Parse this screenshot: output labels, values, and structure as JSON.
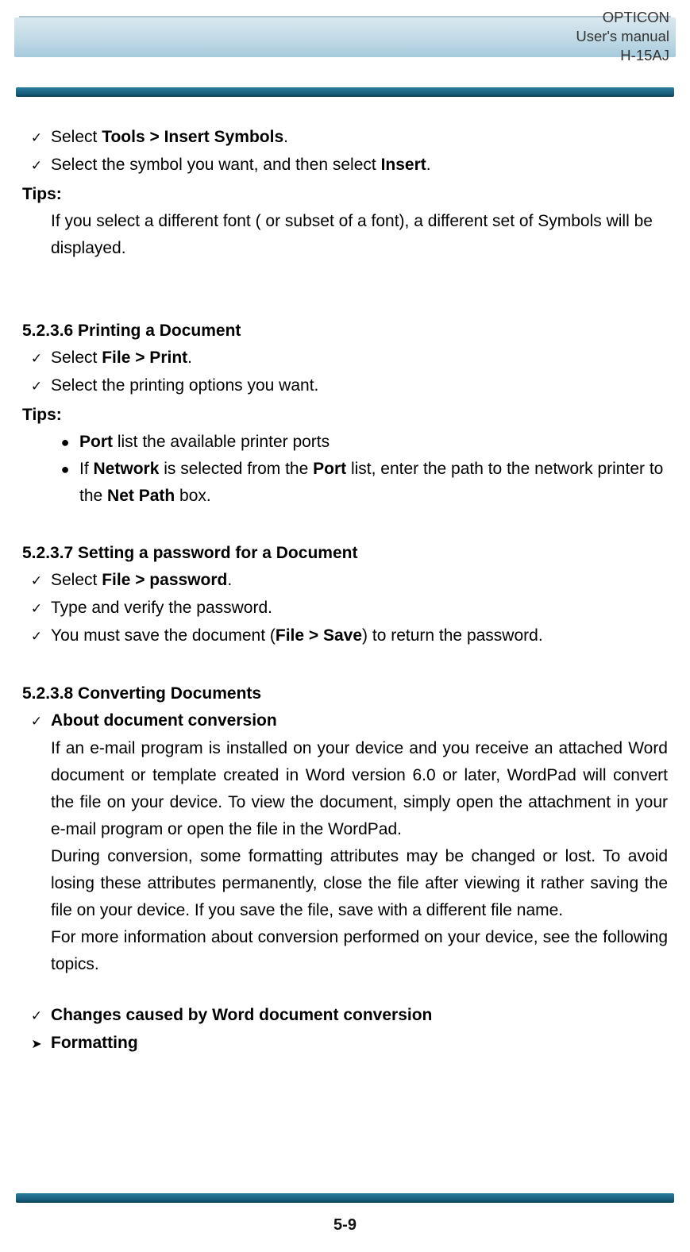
{
  "header": {
    "brand": "OPTICON",
    "doc": "User's manual",
    "model": "H-15AJ"
  },
  "page_number": "5-9",
  "content": {
    "insert_symbols": {
      "step1": {
        "pre": "Select ",
        "bold": "Tools > Insert Symbols",
        "post": "."
      },
      "step2": {
        "pre": "Select the symbol you want, and then select ",
        "bold": "Insert",
        "post": "."
      },
      "tips_label": "Tips:",
      "tip_text": "If you select a different font ( or subset of a font), a different set of Symbols will be displayed."
    },
    "printing": {
      "heading": "5.2.3.6 Printing a Document",
      "step1": {
        "pre": "Select ",
        "bold": "File > Print",
        "post": "."
      },
      "step2": "Select the printing options you want.",
      "tips_label": "Tips:",
      "bullet1": {
        "b1": "Port",
        "rest": " list the available printer ports"
      },
      "bullet2": {
        "p1": "If ",
        "b1": "Network",
        "p2": " is selected from the ",
        "b2": "Port",
        "p3": " list, enter the path to the network printer to the ",
        "b3": "Net Path",
        "p4": " box."
      }
    },
    "password": {
      "heading": "5.2.3.7 Setting a password for a Document",
      "step1": {
        "pre": "Select ",
        "bold": "File > password",
        "post": "."
      },
      "step2": "Type and verify the password.",
      "step3": {
        "p1": "You must save the document (",
        "b": "File > Save",
        "p2": ") to return the password."
      }
    },
    "converting": {
      "heading": "5.2.3.8 Converting Documents",
      "sub1_bold": "About document conversion",
      "sub1_para1": "If an e-mail program is installed on your device and you receive an attached Word document or template created in Word version 6.0 or later, WordPad will convert the file on your device. To view the document, simply open the attachment in your e-mail program or open the file in the WordPad.",
      "sub1_para2": "During conversion, some formatting attributes may be changed or lost. To avoid losing these attributes permanently, close the file after viewing it rather saving the file on your device. If you save the file, save with a different file name.",
      "sub1_para3": "For more information about conversion performed on your device, see the following topics.",
      "sub2_bold": "Changes caused by Word document conversion",
      "sub3_bold": "Formatting"
    }
  }
}
